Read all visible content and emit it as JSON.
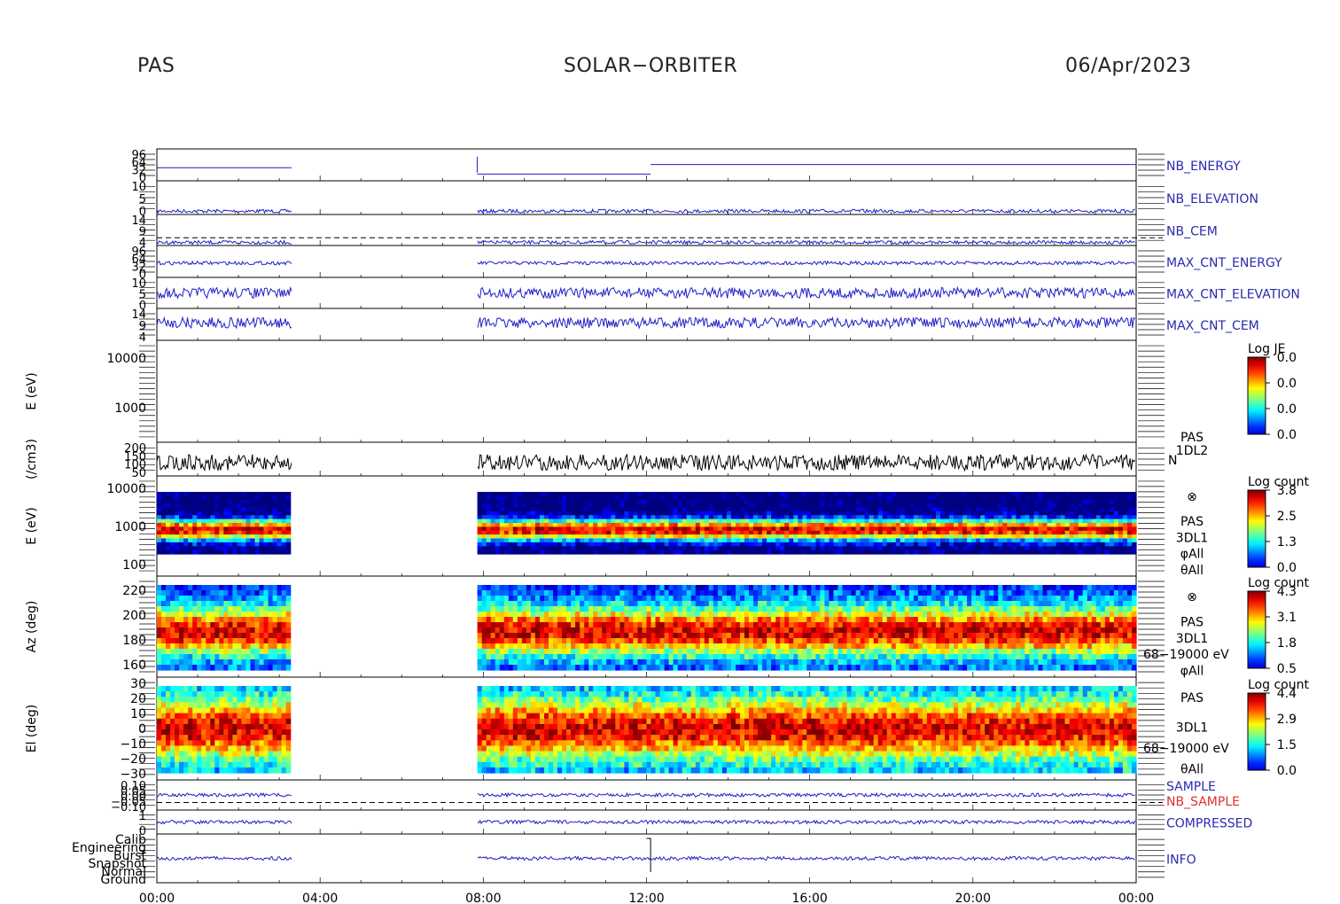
{
  "header": {
    "left": "PAS",
    "center": "SOLAR−ORBITER",
    "right": "06/Apr/2023"
  },
  "colors": {
    "trace_blue": "#1e1ec8",
    "label_blue": "#2a2ab0",
    "label_red": "#e03030",
    "axis_black": "#000000"
  },
  "chart_data": {
    "type": "stacked-panels",
    "x_axis": {
      "ticks": [
        "00:00",
        "04:00",
        "08:00",
        "12:00",
        "16:00",
        "20:00",
        "00:00"
      ],
      "range_hours": [
        0,
        24
      ]
    },
    "data_gaps_hours": [
      [
        3.3,
        7.85
      ]
    ],
    "panels": [
      {
        "id": "nb_energy",
        "label": "NB_ENERGY",
        "label_color": "blue",
        "type": "line",
        "yticks": [
          "96",
          "64",
          "32",
          "0"
        ],
        "steps": [
          [
            0,
            3.3,
            0.3
          ],
          [
            7.85,
            12.1,
            0.1
          ],
          [
            12.1,
            24,
            0.4
          ]
        ]
      },
      {
        "id": "nb_elevation",
        "label": "NB_ELEVATION",
        "label_color": "blue",
        "type": "line",
        "yticks": [
          "10",
          "5",
          "0"
        ],
        "level": 0.1
      },
      {
        "id": "nb_cem",
        "label": "NB_CEM",
        "label_color": "blue",
        "type": "line",
        "yticks": [
          "14",
          "9",
          "4"
        ],
        "level": 0.1
      },
      {
        "id": "max_cnt_energy",
        "label": "MAX_CNT_ENERGY",
        "label_color": "blue",
        "type": "line",
        "yticks": [
          "96",
          "64",
          "32",
          "0"
        ],
        "level": 0.45
      },
      {
        "id": "max_cnt_elevation",
        "label": "MAX_CNT_ELEVATION",
        "label_color": "blue",
        "type": "line",
        "yticks": [
          "10",
          "5",
          "0"
        ],
        "level": 0.5
      },
      {
        "id": "max_cnt_cem",
        "label": "MAX_CNT_CEM",
        "label_color": "blue",
        "type": "line",
        "yticks": [
          "14",
          "9",
          "4"
        ],
        "level": 0.55
      },
      {
        "id": "pas_energy_1dl2",
        "ylabel": "E (eV)",
        "type": "spectrogram-empty",
        "yticks": [
          "10000",
          "1000"
        ],
        "colorbar": {
          "title": "Log JE",
          "ticks": [
            "0.0",
            "0.0",
            "0.0",
            "0.0"
          ]
        }
      },
      {
        "id": "density",
        "ylabel": "(/cm3)",
        "side_label": "N",
        "side_title": [
          "PAS",
          "1DL2"
        ],
        "type": "line",
        "trace_color": "black",
        "yticks": [
          "200",
          "150",
          "100",
          "50"
        ]
      },
      {
        "id": "pas_energy_3dl1",
        "ylabel": "E (eV)",
        "type": "spectrogram",
        "yticks": [
          "10000",
          "1000",
          "100"
        ],
        "side_labels": [
          "⊗",
          "PAS",
          "3DL1",
          "φAll",
          "θAll"
        ],
        "colorbar": {
          "title": "Log count",
          "ticks": [
            "3.8",
            "2.5",
            "1.3",
            "0.0"
          ]
        }
      },
      {
        "id": "pas_azimuth",
        "ylabel": "Az (deg)",
        "type": "spectrogram",
        "yticks": [
          "220",
          "200",
          "180",
          "160"
        ],
        "side_labels": [
          "⊗",
          "PAS",
          "3DL1",
          "68−19000 eV",
          "φAll"
        ],
        "colorbar": {
          "title": "Log count",
          "ticks": [
            "4.3",
            "3.1",
            "1.8",
            "0.5"
          ]
        }
      },
      {
        "id": "pas_elevation",
        "ylabel": "El (deg)",
        "type": "spectrogram",
        "yticks": [
          "30",
          "20",
          "10",
          "0",
          "−10",
          "−20",
          "−30"
        ],
        "side_labels": [
          "PAS",
          "3DL1",
          "68−19000 eV",
          "θAll"
        ],
        "colorbar": {
          "title": "Log count",
          "ticks": [
            "4.4",
            "2.9",
            "1.5",
            "0.0"
          ]
        }
      },
      {
        "id": "sample",
        "labels": [
          "SAMPLE",
          "NB_SAMPLE"
        ],
        "label_colors": [
          "blue",
          "red"
        ],
        "type": "line",
        "yticks": [
          "0.10",
          "0.05",
          "0.00",
          "−0.05",
          "−0.10"
        ]
      },
      {
        "id": "compressed",
        "label": "COMPRESSED",
        "label_color": "blue",
        "type": "line",
        "yticks": [
          "1",
          "0"
        ]
      },
      {
        "id": "info",
        "label": "INFO",
        "label_color": "blue",
        "type": "line",
        "yticks": [
          "Calib",
          "Engineering",
          "Burst",
          "Snapshot",
          "Normal",
          "Ground"
        ]
      }
    ]
  }
}
